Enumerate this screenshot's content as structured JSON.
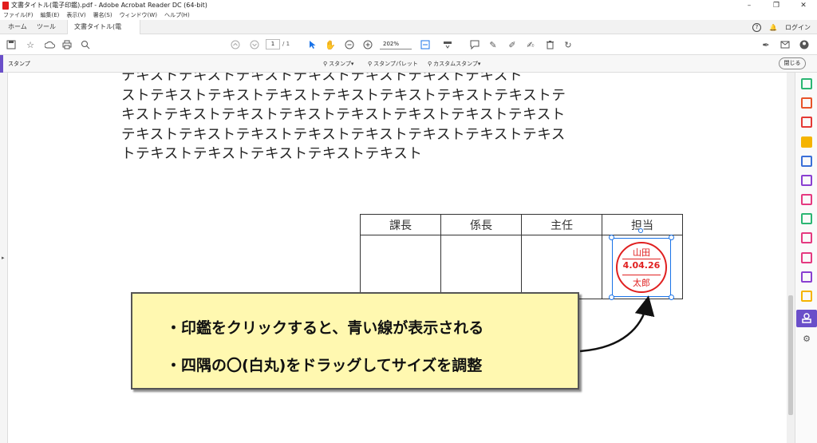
{
  "window": {
    "title": "文書タイトル(電子印鑑).pdf - Adobe Acrobat Reader DC (64-bit)",
    "controls": [
      "–",
      "❐",
      "✕"
    ]
  },
  "menu": [
    "ファイル(F)",
    "編集(E)",
    "表示(V)",
    "署名(S)",
    "ウィンドウ(W)",
    "ヘルプ(H)"
  ],
  "tabs": {
    "home": "ホーム",
    "tools": "ツール",
    "doc": "文書タイトル(電子..."
  },
  "tabs_right": {
    "help": "?",
    "bell": "🔔",
    "login": "ログイン"
  },
  "toolbar": {
    "page_current": "1",
    "page_total": "/ 1",
    "zoom": "202%"
  },
  "stampbar": {
    "label": "スタンプ",
    "stamp": "スタンプ▾",
    "palette": "スタンプパレット",
    "custom": "カスタムスタンプ▾",
    "close": "閉じる"
  },
  "doc_text": [
    "テキストテキストテキストテキストテキストテキストテキスト",
    "ストテキストテキストテキストテキストテキストテキストテキストテ",
    "キストテキストテキストテキストテキストテキストテキストテキスト",
    "テキストテキストテキストテキストテキストテキストテキストテキス",
    "トテキストテキストテキストテキストテキスト"
  ],
  "approval": {
    "headers": [
      "課長",
      "係長",
      "主任",
      "担当"
    ]
  },
  "hanko": {
    "name_top": "山田",
    "date": "4.04.26",
    "name_bottom": "太郎",
    "color": "#e02020"
  },
  "callout": {
    "line1": "・印鑑をクリックすると、青い線が表示される",
    "line2": "・四隅の〇(白丸)をドラッグしてサイズを調整"
  },
  "right_pane_icons": [
    "export-pdf-icon",
    "organize-pages-icon",
    "create-pdf-icon",
    "comment-icon",
    "send-icon",
    "fill-sign-icon",
    "edit-pdf-icon",
    "scan-icon",
    "sign-icon",
    "protect-icon",
    "request-signature-icon",
    "more-tools-icon",
    "stamp-icon",
    "tools-icon"
  ]
}
